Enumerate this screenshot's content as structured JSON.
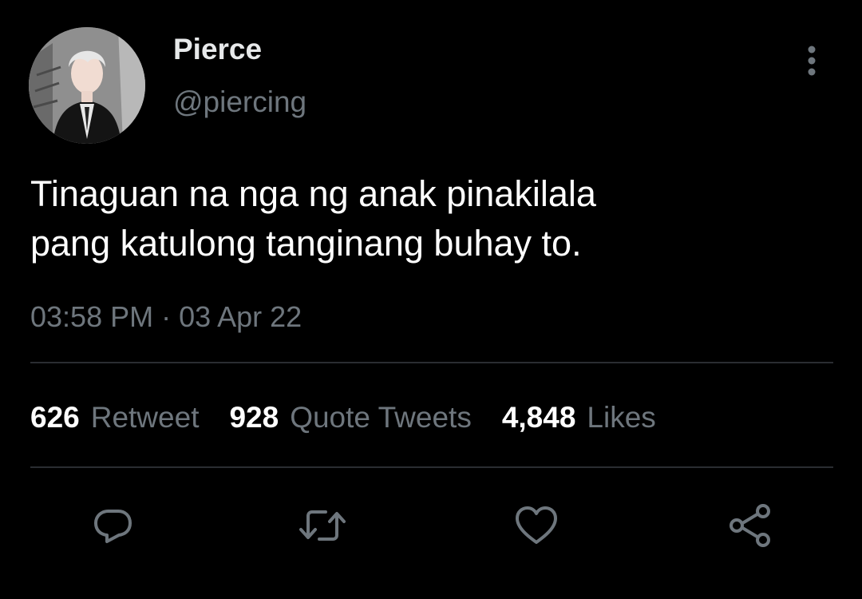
{
  "user": {
    "display_name": "Pierce",
    "handle": "@piercing"
  },
  "tweet": {
    "text": "Tinaguan na nga ng anak pinakilala\npang katulong tanginang buhay to.",
    "timestamp": "03:58 PM · 03 Apr 22"
  },
  "stats": [
    {
      "count": "626",
      "label": "Retweet"
    },
    {
      "count": "928",
      "label": "Quote Tweets"
    },
    {
      "count": "4,848",
      "label": "Likes"
    }
  ],
  "actions": {
    "reply_icon": "reply-icon",
    "retweet_icon": "retweet-icon",
    "like_icon": "heart-icon",
    "share_icon": "share-icon"
  },
  "colors": {
    "background": "#000000",
    "primary_text": "#e7e9ea",
    "secondary_text": "#6e767d",
    "divider": "#2a2d31"
  }
}
